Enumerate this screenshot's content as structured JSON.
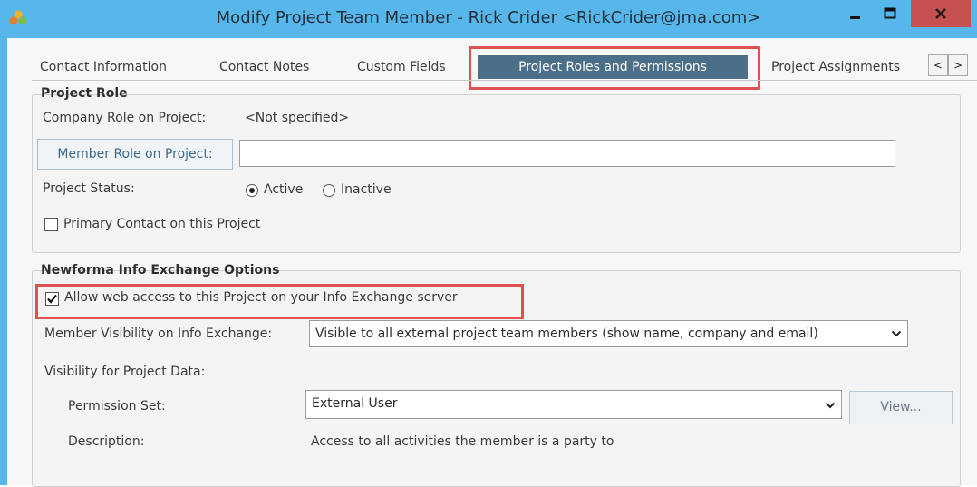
{
  "window": {
    "title": "Modify Project Team Member - Rick Crider <RickCrider@jma.com>",
    "accent": "#58b7ea",
    "close_color": "#c75050"
  },
  "tabs": [
    {
      "label": "Contact Information",
      "active": false
    },
    {
      "label": "Contact Notes",
      "active": false
    },
    {
      "label": "Custom Fields",
      "active": false
    },
    {
      "label": "Project Roles and Permissions",
      "active": true
    },
    {
      "label": "Project Assignments",
      "active": false
    }
  ],
  "tab_scroll": {
    "left": "<",
    "right": ">"
  },
  "project_role": {
    "title": "Project Role",
    "company_role_label": "Company Role on Project:",
    "company_role_value": "<Not specified>",
    "member_role_button": "Member Role on Project:",
    "member_role_value": "",
    "status_label": "Project Status:",
    "status_options": [
      "Active",
      "Inactive"
    ],
    "status_selected": "Active",
    "primary_contact_label": "Primary Contact on this Project",
    "primary_contact_checked": false
  },
  "info_exchange": {
    "title": "Newforma Info Exchange Options",
    "allow_web_access_label": "Allow web access to this Project on your Info Exchange server",
    "allow_web_access_checked": true,
    "visibility_label": "Member Visibility on Info Exchange:",
    "visibility_value": "Visible to all external project team members (show name, company and email)",
    "project_data_label": "Visibility for Project Data:",
    "permission_set_label": "Permission Set:",
    "permission_set_value": "External User",
    "view_button": "View...",
    "description_label": "Description:",
    "description_value": "Access to all activities the member is a party to"
  },
  "highlight_color": "#e05151"
}
